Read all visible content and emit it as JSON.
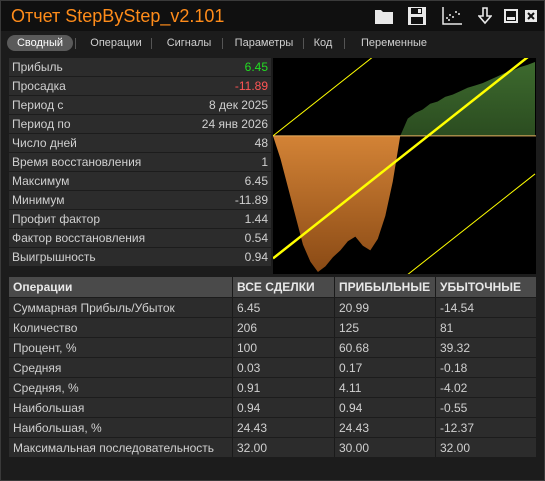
{
  "window": {
    "title": "Отчет StepByStep_v2.101",
    "accent": "#ff8c1a"
  },
  "toolbar": {
    "icons": [
      "folder-icon",
      "save-icon",
      "chart-icon",
      "download-icon",
      "minimize-icon",
      "close-icon"
    ]
  },
  "tabs": [
    {
      "label": "Сводный",
      "active": true
    },
    {
      "label": "Операции",
      "active": false
    },
    {
      "label": "Сигналы",
      "active": false
    },
    {
      "label": "Параметры",
      "active": false
    },
    {
      "label": "Код",
      "active": false
    },
    {
      "label": "Переменные",
      "active": false
    }
  ],
  "stats": [
    {
      "label": "Прибыль",
      "value": "6.45",
      "color": "#22dd22"
    },
    {
      "label": "Просадка",
      "value": "-11.89",
      "color": "#ff5555"
    },
    {
      "label": "Период с",
      "value": "8 дек 2025"
    },
    {
      "label": "Период по",
      "value": "24 янв 2026"
    },
    {
      "label": "Число дней",
      "value": "48"
    },
    {
      "label": "Время восстановления",
      "value": "1"
    },
    {
      "label": "Максимум",
      "value": "6.45"
    },
    {
      "label": "Минимум",
      "value": "-11.89"
    },
    {
      "label": "Профит фактор",
      "value": "1.44"
    },
    {
      "label": "Фактор восстановления",
      "value": "0.54"
    },
    {
      "label": "Выигрышность",
      "value": "0.94"
    }
  ],
  "chart_data": {
    "type": "area",
    "title": "",
    "xlabel": "",
    "ylabel": "",
    "grid": false,
    "ylim": [
      -11.89,
      6.45
    ],
    "series": [
      {
        "values": [
          0,
          -2.0,
          -4.5,
          -7.0,
          -9.5,
          -11.0,
          -11.89,
          -11.4,
          -10.6,
          -10.0,
          -9.2,
          -8.8,
          -9.6,
          -10.0,
          -9.0,
          -7.0,
          -4.0,
          0,
          1.5,
          2.0,
          2.3,
          2.8,
          3.0,
          3.4,
          3.6,
          3.9,
          4.2,
          4.4,
          4.6,
          4.9,
          5.2,
          5.5,
          5.7,
          6.0,
          6.2,
          6.45
        ]
      }
    ],
    "colors": {
      "loss": "#d38336",
      "profit": "#3d6a2e",
      "trend": "#ffff00"
    }
  },
  "operations": {
    "headers": [
      "Операции",
      "ВСЕ СДЕЛКИ",
      "ПРИБЫЛЬНЫЕ",
      "УБЫТОЧНЫЕ"
    ],
    "rows": [
      [
        "Суммарная Прибыль/Убыток",
        "6.45",
        "20.99",
        "-14.54"
      ],
      [
        "Количество",
        "206",
        "125",
        "81"
      ],
      [
        "Процент, %",
        "100",
        "60.68",
        "39.32"
      ],
      [
        "Средняя",
        "0.03",
        "0.17",
        "-0.18"
      ],
      [
        "Средняя, %",
        "0.91",
        "4.11",
        "-4.02"
      ],
      [
        "Наибольшая",
        "0.94",
        "0.94",
        "-0.55"
      ],
      [
        "Наибольшая, %",
        "24.43",
        "24.43",
        "-12.37"
      ],
      [
        "Максимальная последовательность",
        "32.00",
        "30.00",
        "32.00"
      ]
    ]
  }
}
